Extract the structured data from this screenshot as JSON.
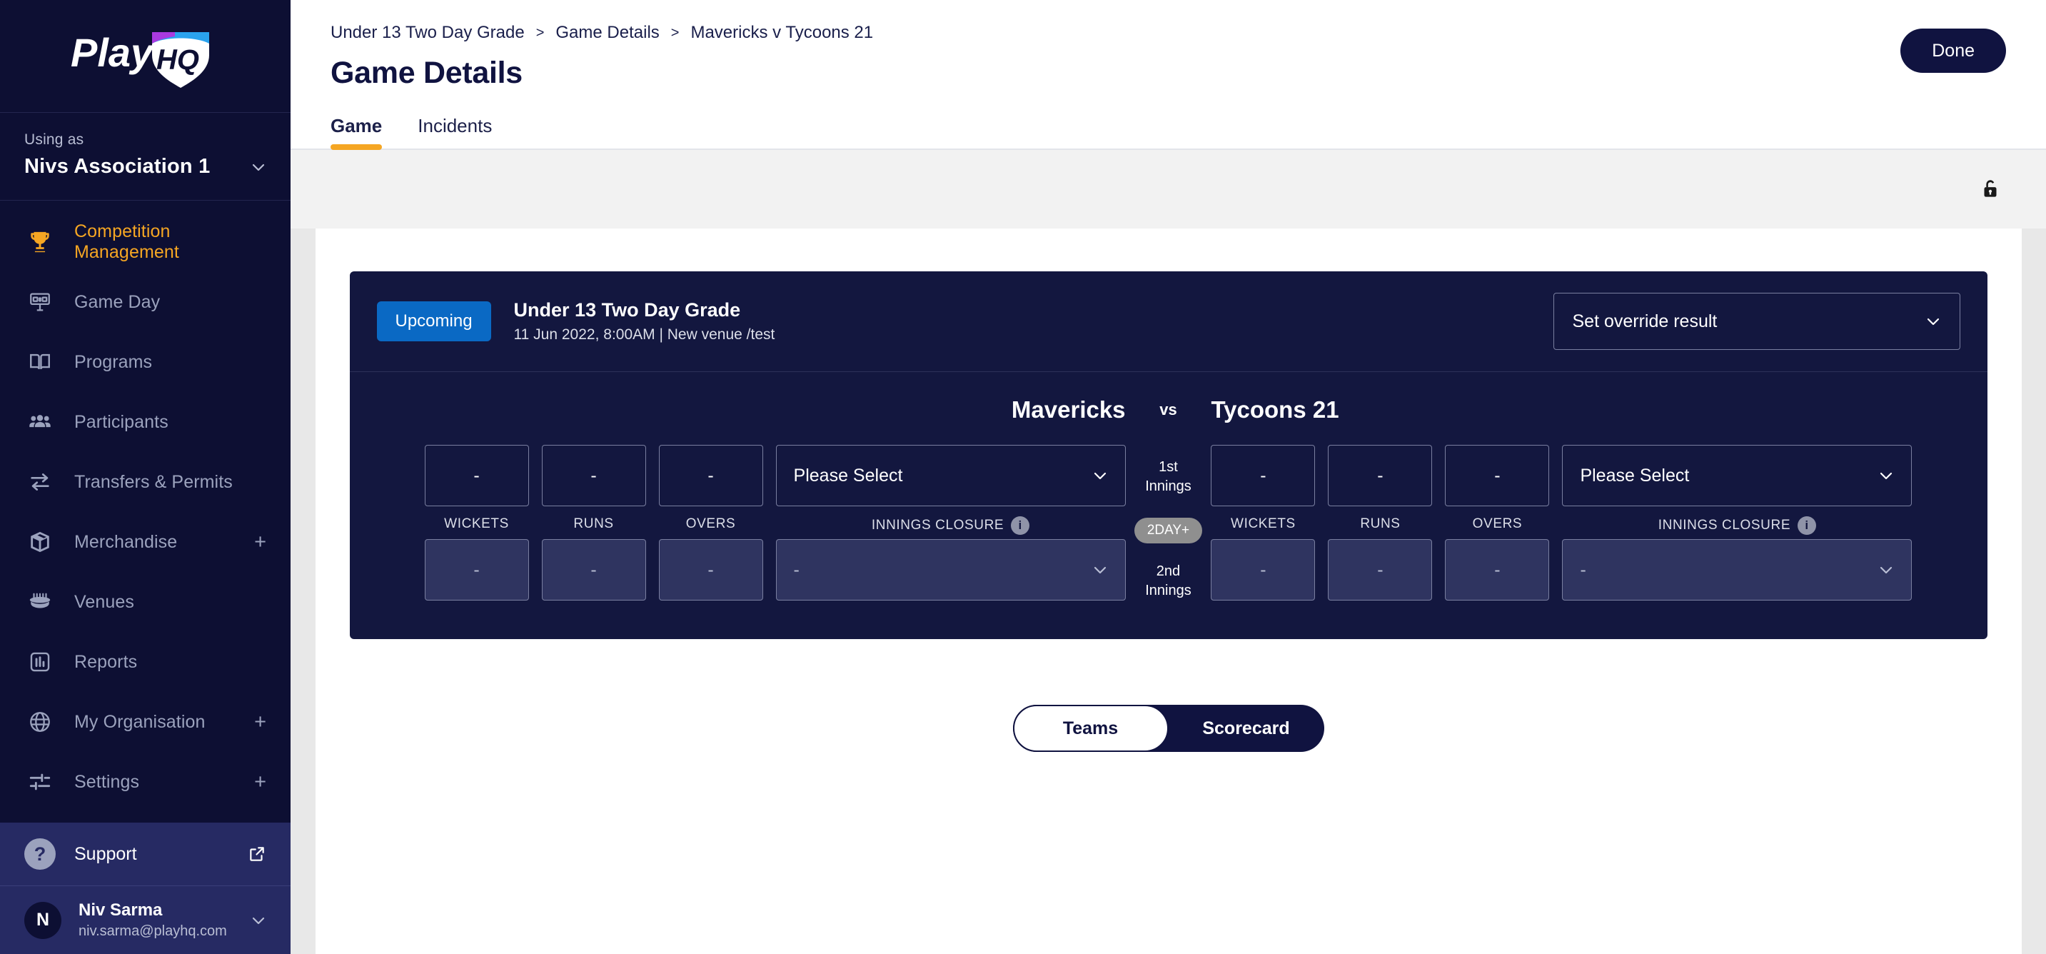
{
  "sidebar": {
    "logo_text": "PlayHQ",
    "using_as_label": "Using as",
    "org_name": "Nivs Association 1",
    "items": [
      {
        "label": "Competition Management",
        "icon": "trophy-icon",
        "active": true,
        "expandable": false
      },
      {
        "label": "Game Day",
        "icon": "scoreboard-icon",
        "active": false,
        "expandable": false
      },
      {
        "label": "Programs",
        "icon": "book-icon",
        "active": false,
        "expandable": false
      },
      {
        "label": "Participants",
        "icon": "people-icon",
        "active": false,
        "expandable": false
      },
      {
        "label": "Transfers & Permits",
        "icon": "transfer-arrows-icon",
        "active": false,
        "expandable": false
      },
      {
        "label": "Merchandise",
        "icon": "box-icon",
        "active": false,
        "expandable": true,
        "expand_glyph": "+"
      },
      {
        "label": "Venues",
        "icon": "stadium-icon",
        "active": false,
        "expandable": false
      },
      {
        "label": "Reports",
        "icon": "chart-icon",
        "active": false,
        "expandable": false
      },
      {
        "label": "My Organisation",
        "icon": "globe-icon",
        "active": false,
        "expandable": true,
        "expand_glyph": "+"
      },
      {
        "label": "Settings",
        "icon": "sliders-icon",
        "active": false,
        "expandable": true,
        "expand_glyph": "+"
      }
    ],
    "support": {
      "label": "Support",
      "badge": "?"
    },
    "user": {
      "initial": "N",
      "name": "Niv Sarma",
      "email": "niv.sarma@playhq.com"
    }
  },
  "header": {
    "breadcrumb": [
      "Under 13 Two Day Grade",
      "Game Details",
      "Mavericks v Tycoons 21"
    ],
    "breadcrumb_separator": ">",
    "title": "Game Details",
    "done_label": "Done"
  },
  "tabs": [
    {
      "label": "Game",
      "active": true
    },
    {
      "label": "Incidents",
      "active": false
    }
  ],
  "subbar": {
    "lock_icon": "unlock-icon"
  },
  "match": {
    "status": "Upcoming",
    "grade": "Under 13 Two Day Grade",
    "datetime_venue": "11 Jun 2022, 8:00AM | New venue /test",
    "override": {
      "value": "Set override result"
    },
    "home_team": "Mavericks",
    "away_team": "Tycoons 21",
    "vs": "vs",
    "labels": {
      "wickets": "WICKETS",
      "runs": "RUNS",
      "overs": "OVERS",
      "innings_closure": "INNINGS CLOSURE",
      "info_glyph": "i"
    },
    "center": {
      "first_innings": "1st\nInnings",
      "first_innings_line1": "1st",
      "first_innings_line2": "Innings",
      "format_badge": "2DAY+",
      "second_innings_line1": "2nd",
      "second_innings_line2": "Innings"
    },
    "innings": {
      "first": {
        "home": {
          "wickets": "-",
          "runs": "-",
          "overs": "-",
          "closure": "Please Select",
          "disabled": false
        },
        "away": {
          "wickets": "-",
          "runs": "-",
          "overs": "-",
          "closure": "Please Select",
          "disabled": false
        }
      },
      "second": {
        "home": {
          "wickets": "-",
          "runs": "-",
          "overs": "-",
          "closure": "-",
          "disabled": true
        },
        "away": {
          "wickets": "-",
          "runs": "-",
          "overs": "-",
          "closure": "-",
          "disabled": true
        }
      }
    }
  },
  "bottom_toggle": [
    {
      "label": "Teams",
      "active": true
    },
    {
      "label": "Scorecard",
      "active": false
    }
  ],
  "colors": {
    "sidebar_bg": "#0d0f33",
    "sidebar_accent": "#f5a623",
    "support_bg": "#262a63",
    "card_bg": "#13173f",
    "status_blue": "#0a69c4",
    "dark_navy": "#101340",
    "disabled_field": "#2f3460"
  }
}
